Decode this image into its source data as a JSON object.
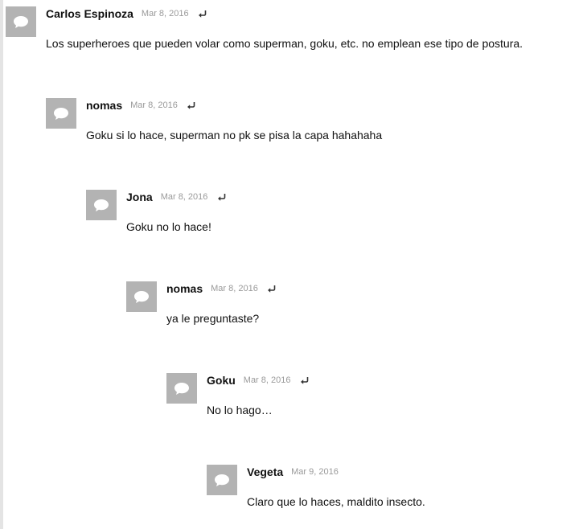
{
  "icons": {
    "avatar": "comment-bubble-icon",
    "reply": "reply-arrow-icon"
  },
  "colors": {
    "avatar_bg": "#b3b3b3",
    "date_text": "#9a9a9a",
    "text": "#111111"
  },
  "comments": [
    {
      "author": "Carlos Espinoza",
      "date": "Mar 8, 2016",
      "text": "Los superheroes que pueden volar como superman, goku, etc. no emplean ese tipo de postura.",
      "depth": 0
    },
    {
      "author": "nomas",
      "date": "Mar 8, 2016",
      "text": "Goku si lo hace, superman no pk se pisa la capa hahahaha",
      "depth": 1
    },
    {
      "author": "Jona",
      "date": "Mar 8, 2016",
      "text": "Goku no lo hace!",
      "depth": 2
    },
    {
      "author": "nomas",
      "date": "Mar 8, 2016",
      "text": "ya le preguntaste?",
      "depth": 3
    },
    {
      "author": "Goku",
      "date": "Mar 8, 2016",
      "text": "No lo hago…",
      "depth": 4
    },
    {
      "author": "Vegeta",
      "date": "Mar 9, 2016",
      "text": "Claro que lo haces, maldito insecto.",
      "depth": 5,
      "no_reply": true
    }
  ]
}
